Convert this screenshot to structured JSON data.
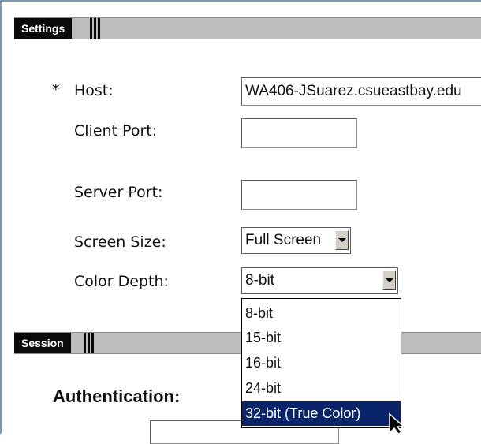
{
  "settings": {
    "section_title": "Settings",
    "required_marker": "*",
    "host": {
      "label": "Host:",
      "value": "WA406-JSuarez.csueastbay.edu"
    },
    "client_port": {
      "label": "Client Port:",
      "value": ""
    },
    "server_port": {
      "label": "Server Port:",
      "value": ""
    },
    "screen_size": {
      "label": "Screen Size:",
      "selected": "Full Screen"
    },
    "color_depth": {
      "label": "Color Depth:",
      "selected": "8-bit",
      "options": [
        "8-bit",
        "15-bit",
        "16-bit",
        "24-bit",
        "32-bit (True Color)"
      ],
      "highlighted": "32-bit (True Color)"
    }
  },
  "session": {
    "section_title": "Session",
    "authentication_label": "Authentication:"
  },
  "colors": {
    "section_tab": "#0a0a0a",
    "section_bar": "#bdbdbd",
    "highlight": "#0a246a",
    "frame": "#7d95b8"
  }
}
